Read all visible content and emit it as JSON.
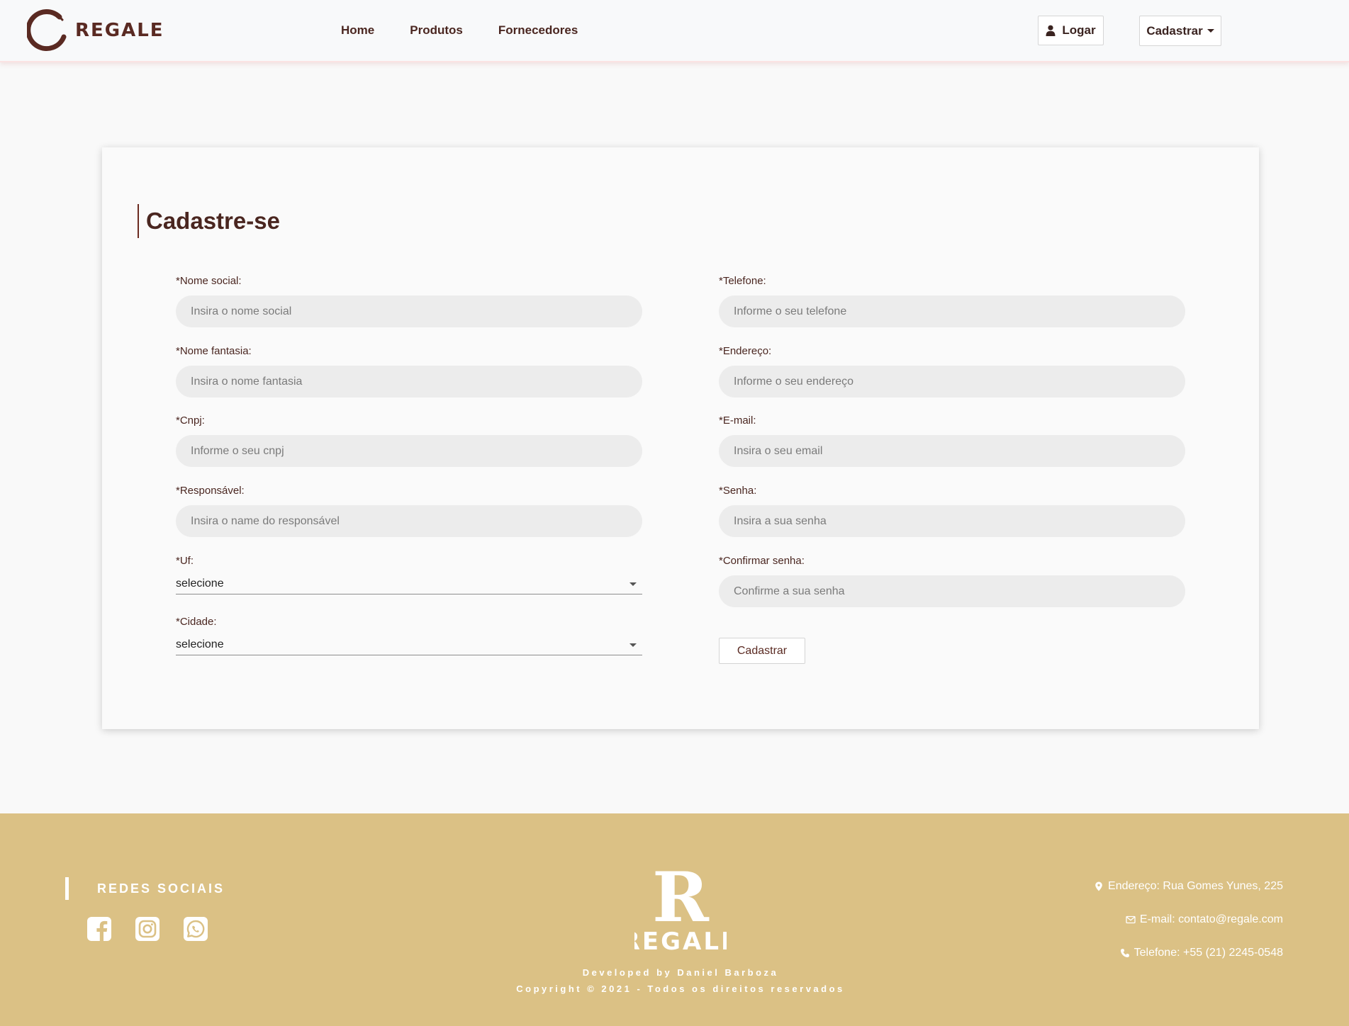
{
  "brand": {
    "name": "REGALE"
  },
  "nav": {
    "links": [
      "Home",
      "Produtos",
      "Fornecedores"
    ],
    "login_label": "Logar",
    "register_label": "Cadastrar"
  },
  "form": {
    "title": "Cadastre-se",
    "left": [
      {
        "label": "*Nome social:",
        "placeholder": "Insira o nome social"
      },
      {
        "label": "*Nome fantasia:",
        "placeholder": "Insira o nome fantasia"
      },
      {
        "label": "*Cnpj:",
        "placeholder": "Informe o seu cnpj"
      },
      {
        "label": "*Responsável:",
        "placeholder": "Insira o name do responsável"
      }
    ],
    "selects": [
      {
        "label": "*Uf:",
        "value": "selecione"
      },
      {
        "label": "*Cidade:",
        "value": "selecione"
      }
    ],
    "right": [
      {
        "label": "*Telefone:",
        "placeholder": "Informe o seu telefone"
      },
      {
        "label": "*Endereço:",
        "placeholder": "Informe o seu endereço"
      },
      {
        "label": "*E-mail:",
        "placeholder": "Insira o seu email"
      },
      {
        "label": "*Senha:",
        "placeholder": "Insira a sua senha"
      },
      {
        "label": "*Confirmar senha:",
        "placeholder": "Confirme a sua senha"
      }
    ],
    "submit_label": "Cadastrar"
  },
  "footer": {
    "social_title": "REDES SOCIAIS",
    "social_icons": [
      "facebook-icon",
      "instagram-icon",
      "whatsapp-icon"
    ],
    "logo_letter": "R",
    "logo_text": "REGALE",
    "developed_by": "Developed by Daniel Barboza",
    "copyright": "Copyright © 2021 - Todos os direitos reservados",
    "address": "Endereço: Rua Gomes Yunes, 225",
    "email": "E-mail: contato@regale.com",
    "phone": "Telefone: +55 (21) 2245-0548"
  },
  "colors": {
    "brand": "#4a2620",
    "footer_bg": "#dbc185",
    "input_bg": "#ececec"
  }
}
